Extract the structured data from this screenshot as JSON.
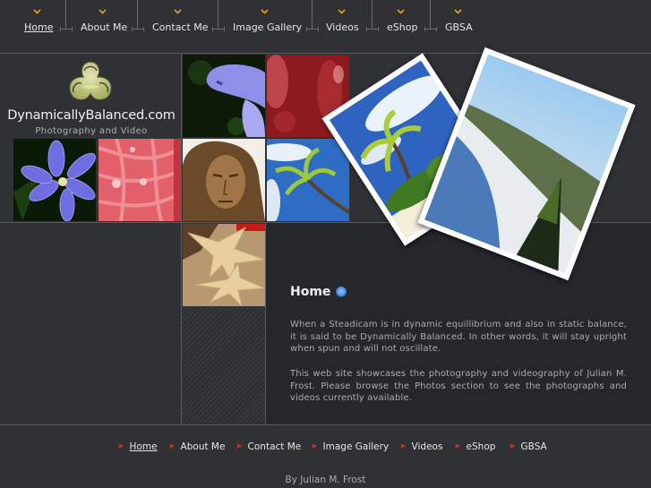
{
  "top_nav": {
    "items": [
      {
        "label": "Home",
        "active": true
      },
      {
        "label": "About Me",
        "active": false
      },
      {
        "label": "Contact Me",
        "active": false
      },
      {
        "label": "Image Gallery",
        "active": false
      },
      {
        "label": "Videos",
        "active": false
      },
      {
        "label": "eShop",
        "active": false
      },
      {
        "label": "GBSA",
        "active": false
      }
    ]
  },
  "logo": {
    "title": "DynamicallyBalanced.com",
    "subtitle": "Photography and Video"
  },
  "gallery": {
    "thumbnails": [
      {
        "subject": "blue flower petal close-up"
      },
      {
        "subject": "red flower macro"
      },
      {
        "subject": "blue star flower"
      },
      {
        "subject": "pink gerbera with water drops"
      },
      {
        "subject": "bronze statue face"
      },
      {
        "subject": "palm tree against blue sky"
      },
      {
        "subject": "starfish on sand"
      }
    ],
    "featured_photos": [
      {
        "subject": "palm trees on beach"
      },
      {
        "subject": "coastal fog and mountains with pine tree"
      }
    ]
  },
  "content": {
    "title": "Home",
    "paragraphs": [
      "When a Steadicam is in dynamic equillibrium and also in static balance, it is said to be Dynamically Balanced.  In other words, it will stay upright when spun and will not oscillate.",
      "This web site showcases the photography and videography of Julian M. Frost.  Please browse the Photos section to see the photographs and videos currently available."
    ]
  },
  "footer": {
    "nav": [
      {
        "label": "Home",
        "active": true
      },
      {
        "label": "About Me",
        "active": false
      },
      {
        "label": "Contact Me",
        "active": false
      },
      {
        "label": "Image Gallery",
        "active": false
      },
      {
        "label": "Videos",
        "active": false
      },
      {
        "label": "eShop",
        "active": false
      },
      {
        "label": "GBSA",
        "active": false
      }
    ],
    "credit": "By Julian M. Frost"
  },
  "colors": {
    "background": "#303135",
    "content_background": "#26272b",
    "nav_chevron": "#e8a020",
    "footer_bullet": "#d03a1a",
    "logo_green": "#c8cc88"
  }
}
